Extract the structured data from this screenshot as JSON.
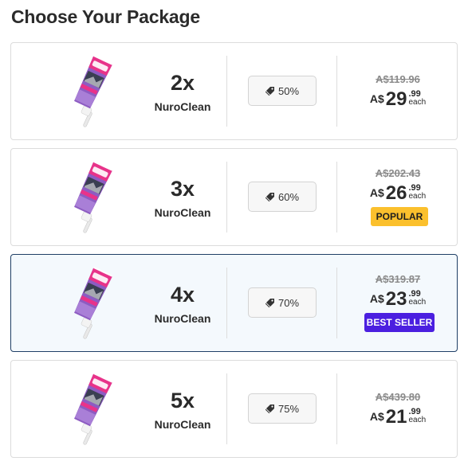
{
  "page": {
    "title": "Choose Your Package"
  },
  "packages": [
    {
      "qty": "2x",
      "name": "NuroClean",
      "discount": "50%",
      "old_price": "A$119.96",
      "currency": "A$",
      "price_whole": "29",
      "price_cents": ".99",
      "unit": "each",
      "badge": ""
    },
    {
      "qty": "3x",
      "name": "NuroClean",
      "discount": "60%",
      "old_price": "A$202.43",
      "currency": "A$",
      "price_whole": "26",
      "price_cents": ".99",
      "unit": "each",
      "badge": "POPULAR"
    },
    {
      "qty": "4x",
      "name": "NuroClean",
      "discount": "70%",
      "old_price": "A$319.87",
      "currency": "A$",
      "price_whole": "23",
      "price_cents": ".99",
      "unit": "each",
      "badge": "BEST SELLER",
      "selected": true
    },
    {
      "qty": "5x",
      "name": "NuroClean",
      "discount": "75%",
      "old_price": "A$439.80",
      "currency": "A$",
      "price_whole": "21",
      "price_cents": ".99",
      "unit": "each",
      "badge": ""
    }
  ],
  "icons": {
    "discount": "tag-icon",
    "product": "product-tube-image"
  },
  "colors": {
    "popular_badge": "#fbc02d",
    "best_seller_badge": "#4b1fe0",
    "selected_border": "#1f3f66"
  }
}
